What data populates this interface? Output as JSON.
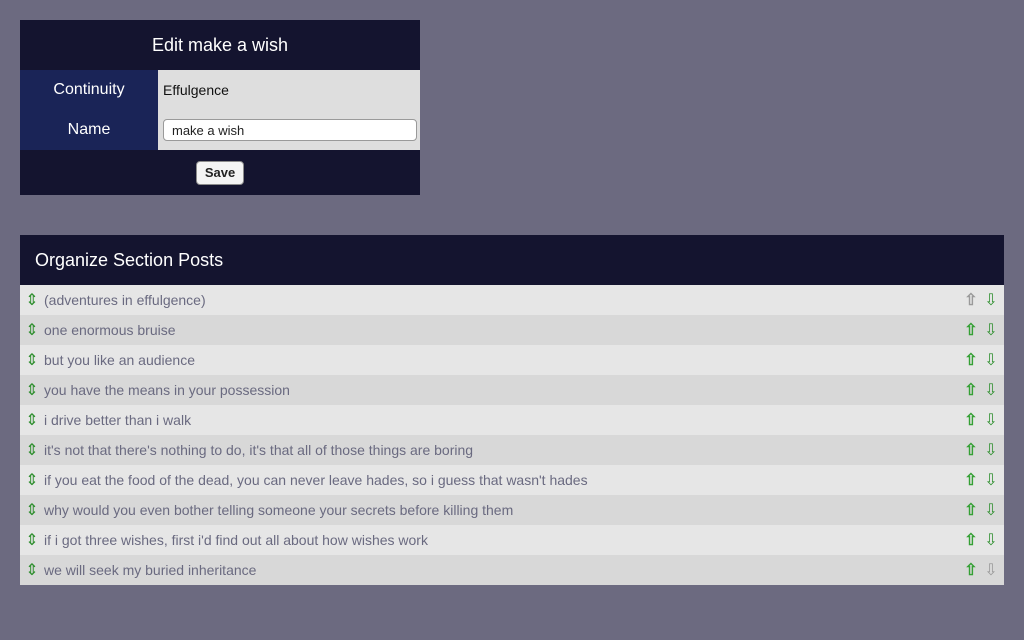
{
  "edit_form": {
    "title": "Edit make a wish",
    "continuity_label": "Continuity",
    "continuity_value": "Effulgence",
    "name_label": "Name",
    "name_value": "make a wish",
    "save_label": "Save"
  },
  "organize": {
    "title": "Organize Section Posts",
    "posts": [
      {
        "title": "(adventures in effulgence)",
        "up_enabled": false,
        "down_enabled": true
      },
      {
        "title": "one enormous bruise",
        "up_enabled": true,
        "down_enabled": true
      },
      {
        "title": "but you like an audience",
        "up_enabled": true,
        "down_enabled": true
      },
      {
        "title": "you have the means in your possession",
        "up_enabled": true,
        "down_enabled": true
      },
      {
        "title": "i drive better than i walk",
        "up_enabled": true,
        "down_enabled": true
      },
      {
        "title": "it's not that there's nothing to do, it's that all of those things are boring",
        "up_enabled": true,
        "down_enabled": true
      },
      {
        "title": "if you eat the food of the dead, you can never leave hades, so i guess that wasn't hades",
        "up_enabled": true,
        "down_enabled": true
      },
      {
        "title": "why would you even bother telling someone your secrets before killing them",
        "up_enabled": true,
        "down_enabled": true
      },
      {
        "title": "if i got three wishes, first i'd find out all about how wishes work",
        "up_enabled": true,
        "down_enabled": true
      },
      {
        "title": "we will seek my buried inheritance",
        "up_enabled": true,
        "down_enabled": false
      }
    ]
  },
  "icons": {
    "drag": "drag-handle-icon",
    "up": "arrow-up-icon",
    "down": "arrow-down-icon"
  }
}
